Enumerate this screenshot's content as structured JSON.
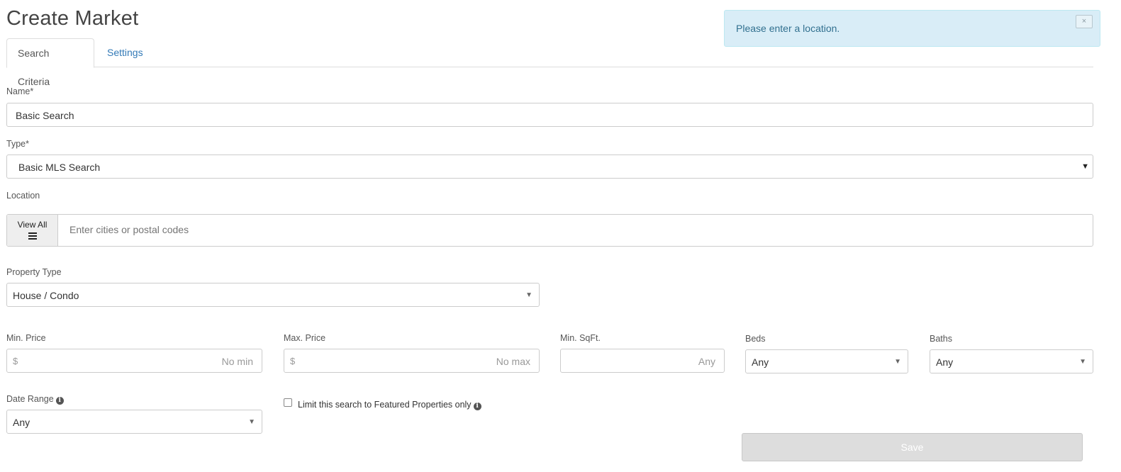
{
  "page_title": "Create Market",
  "alert": {
    "message": "Please enter a location.",
    "close_label": "×"
  },
  "tabs": [
    {
      "label": "Search Criteria",
      "active": true
    },
    {
      "label": "Settings",
      "active": false
    }
  ],
  "form": {
    "name": {
      "label": "Name*",
      "value": "Basic Search"
    },
    "type": {
      "label": "Type*",
      "selected": "Basic MLS Search"
    },
    "location": {
      "label": "Location",
      "view_all_label": "View All",
      "placeholder": "Enter cities or postal codes"
    },
    "property_type": {
      "label": "Property Type",
      "selected": "House / Condo"
    },
    "min_price": {
      "label": "Min. Price",
      "prefix": "$",
      "placeholder": "No min"
    },
    "max_price": {
      "label": "Max. Price",
      "prefix": "$",
      "placeholder": "No max"
    },
    "min_sqft": {
      "label": "Min. SqFt.",
      "placeholder": "Any"
    },
    "beds": {
      "label": "Beds",
      "selected": "Any"
    },
    "baths": {
      "label": "Baths",
      "selected": "Any"
    },
    "date_range": {
      "label": "Date Range",
      "selected": "Any"
    },
    "featured_only": {
      "label": "Limit this search to Featured Properties only",
      "checked": false
    },
    "save_label": "Save"
  },
  "icons": {
    "info": "info-circle-icon",
    "list": "list-icon",
    "caret": "caret-down-icon"
  },
  "colors": {
    "alert_bg": "#d9edf7",
    "alert_text": "#31708f",
    "link": "#337ab7",
    "save_disabled_bg": "#dddddd"
  }
}
